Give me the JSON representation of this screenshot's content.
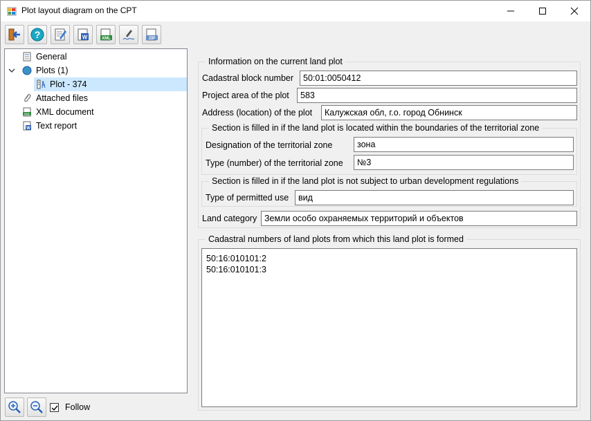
{
  "window": {
    "title": "Plot layout diagram on the CPT"
  },
  "toolbar": {
    "buttons": [
      "exit-icon",
      "help-icon",
      "edit-icon",
      "word-export-icon",
      "xml-export-icon",
      "signature-icon",
      "zip-export-icon"
    ]
  },
  "tree": {
    "items": [
      {
        "label": "General",
        "icon": "document-icon"
      },
      {
        "label": "Plots (1)",
        "icon": "globe-icon",
        "expanded": true
      },
      {
        "label": "Plot - 374",
        "icon": "plot-icon",
        "selected": true
      },
      {
        "label": "Attached files",
        "icon": "paperclip-icon"
      },
      {
        "label": "XML document",
        "icon": "xml-file-icon"
      },
      {
        "label": "Text report",
        "icon": "word-file-icon"
      }
    ]
  },
  "bottom": {
    "follow_label": "Follow",
    "follow_checked": true
  },
  "info": {
    "legend": "Information on the current land plot",
    "cadastral_block_label": "Cadastral block number",
    "cadastral_block_value": "50:01:0050412",
    "project_area_label": "Project area of the plot",
    "project_area_value": "583",
    "address_label": "Address (location) of the plot",
    "address_value": "Калужская обл,  г.о. город Обнинск",
    "zone_section": {
      "legend": "Section is filled in if the land plot is located within the boundaries of the territorial zone",
      "designation_label": "Designation of the territorial zone",
      "designation_value": "зона",
      "type_label": "Type (number) of the territorial zone",
      "type_value": "№3"
    },
    "urban_section": {
      "legend": "Section is filled in if the land plot is not subject to urban development regulations",
      "permitted_use_label": "Type of permitted use",
      "permitted_use_value": "вид"
    },
    "land_category_label": "Land category",
    "land_category_value": "Земли особо охраняемых территорий и объектов"
  },
  "source_plots": {
    "legend": "Cadastral numbers of land plots from which this land plot is formed",
    "lines": [
      "50:16:010101:2",
      "50:16:010101:3"
    ]
  }
}
